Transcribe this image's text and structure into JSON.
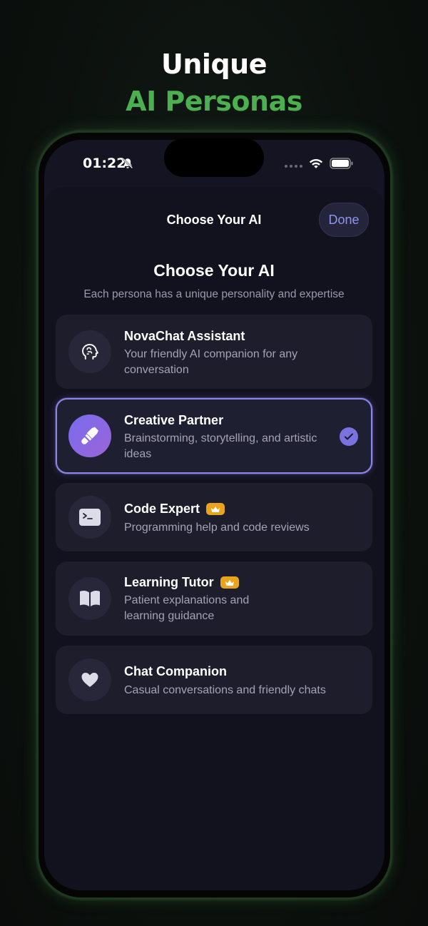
{
  "headline": {
    "line1": "Unique",
    "line2": "AI Personas"
  },
  "status_bar": {
    "time": "01:22"
  },
  "nav": {
    "title": "Choose Your AI",
    "done_label": "Done"
  },
  "section": {
    "title": "Choose Your AI",
    "subtitle": "Each persona has a unique personality and expertise"
  },
  "personas": [
    {
      "name": "NovaChat Assistant",
      "description": "Your friendly AI companion for any conversation",
      "icon": "brain-icon",
      "premium": false,
      "selected": false
    },
    {
      "name": "Creative Partner",
      "description": "Brainstorming, storytelling, and artistic ideas",
      "icon": "paintbrush-icon",
      "premium": false,
      "selected": true
    },
    {
      "name": "Code Expert",
      "description": "Programming help and code reviews",
      "icon": "terminal-icon",
      "premium": true,
      "selected": false
    },
    {
      "name": "Learning Tutor",
      "description": "Patient explanations and learning guidance",
      "icon": "book-icon",
      "premium": true,
      "selected": false
    },
    {
      "name": "Chat Companion",
      "description": "Casual conversations and friendly chats",
      "icon": "heart-icon",
      "premium": false,
      "selected": false
    }
  ],
  "colors": {
    "accent_green": "#4caf50",
    "accent_purple": "#7b72e0",
    "premium_badge": "#e8a41a",
    "background": "#12121e"
  }
}
